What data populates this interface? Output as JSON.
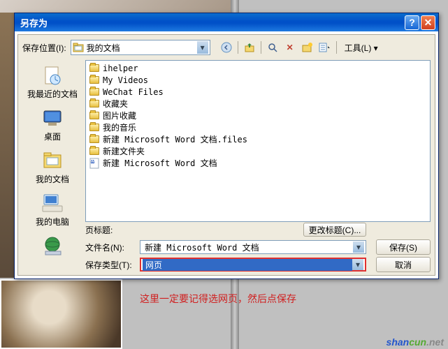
{
  "dialog": {
    "title": "另存为"
  },
  "toolbar": {
    "location_label": "保存位置(I):",
    "location_value": "我的文档",
    "tools_label": "工具(L)"
  },
  "sidebar": {
    "items": [
      {
        "label": "我最近的文档"
      },
      {
        "label": "桌面"
      },
      {
        "label": "我的文档"
      },
      {
        "label": "我的电脑"
      },
      {
        "label": ""
      }
    ]
  },
  "files": [
    {
      "name": "ihelper",
      "type": "folder"
    },
    {
      "name": "My Videos",
      "type": "folder"
    },
    {
      "name": "WeChat Files",
      "type": "folder"
    },
    {
      "name": "收藏夹",
      "type": "folder"
    },
    {
      "name": "图片收藏",
      "type": "folder"
    },
    {
      "name": "我的音乐",
      "type": "folder"
    },
    {
      "name": "新建 Microsoft Word 文档.files",
      "type": "folder"
    },
    {
      "name": "新建文件夹",
      "type": "folder"
    },
    {
      "name": "新建 Microsoft Word 文档",
      "type": "word"
    }
  ],
  "bottom": {
    "page_title_label": "页标题:",
    "page_title_value": "",
    "change_title_button": "更改标题(C)...",
    "filename_label": "文件名(N):",
    "filename_value": "新建 Microsoft Word 文档",
    "filetype_label": "保存类型(T):",
    "filetype_value": "网页",
    "save_button": "保存(S)",
    "cancel_button": "取消"
  },
  "annotation": "这里一定要记得选网页，然后点保存",
  "watermark1": "shan",
  "watermark2": "cun",
  "watermark3": ".net"
}
